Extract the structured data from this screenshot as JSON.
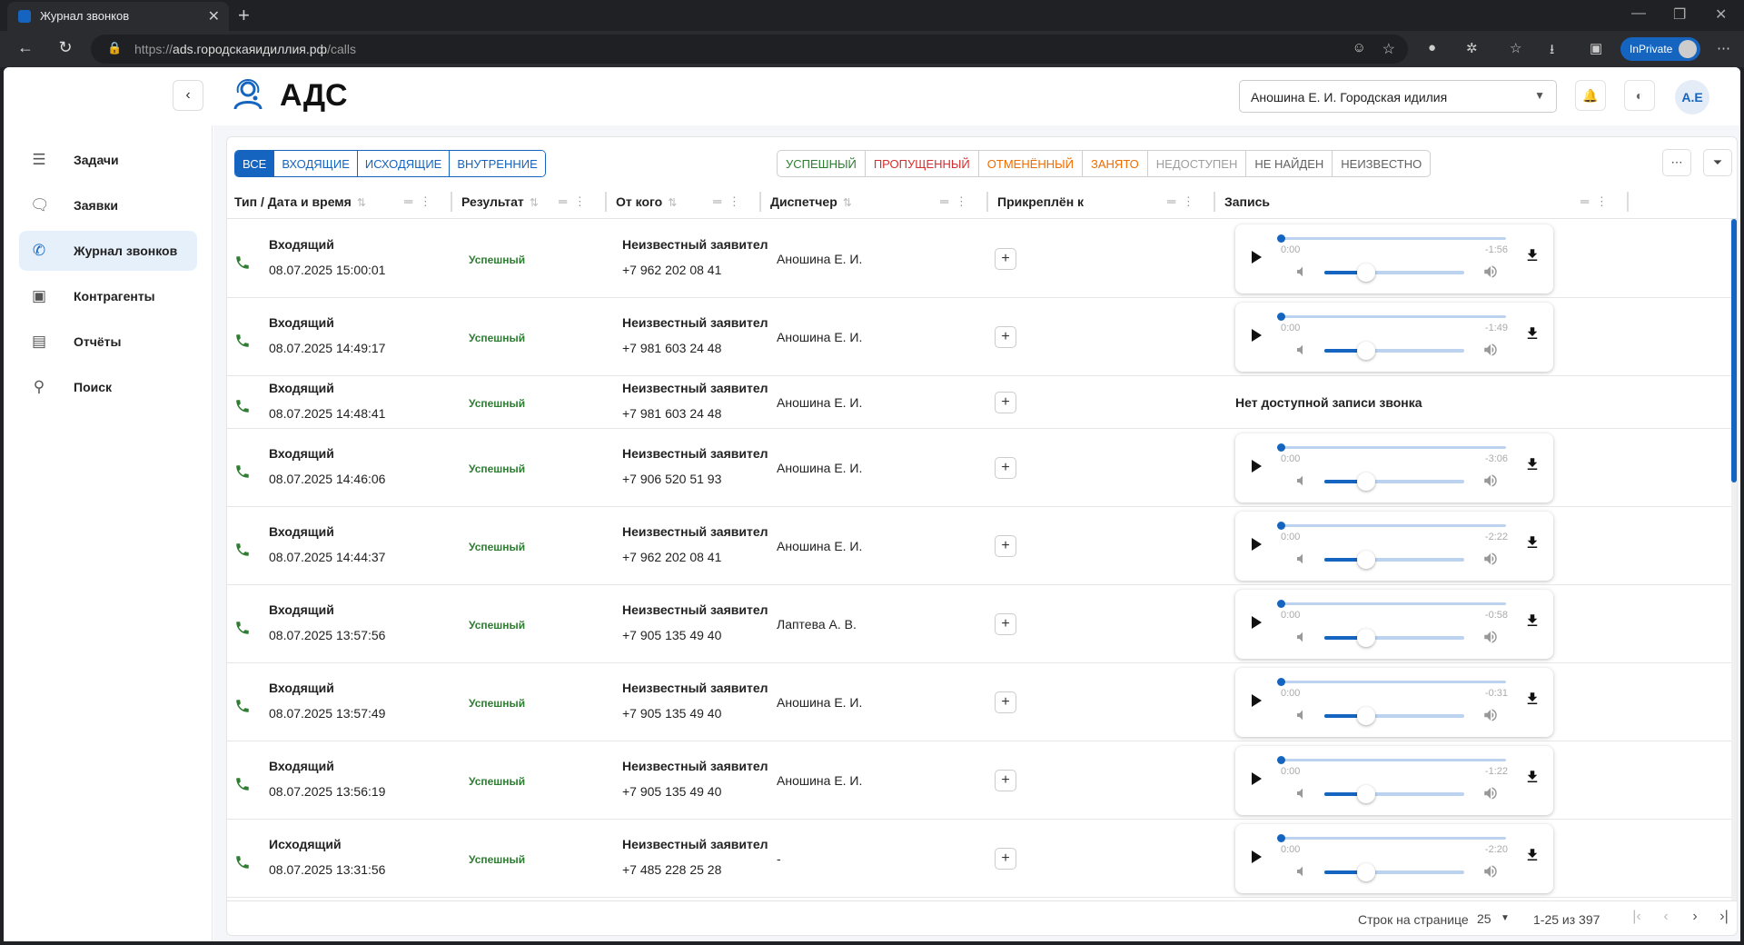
{
  "browser": {
    "tab_title": "Журнал звонков",
    "url_scheme": "https://",
    "url_host": "ads.городскаяидиллия.рф",
    "url_path": "/calls",
    "inprivate_label": "InPrivate"
  },
  "header": {
    "app_title": "АДС",
    "org_select_value": "Аношина Е. И. Городская идилия",
    "avatar_initials": "А.Е"
  },
  "sidebar": {
    "items": [
      {
        "label": "Задачи",
        "icon": "tasks-icon"
      },
      {
        "label": "Заявки",
        "icon": "requests-icon"
      },
      {
        "label": "Журнал звонков",
        "icon": "call-log-icon",
        "active": true
      },
      {
        "label": "Контрагенты",
        "icon": "contacts-icon"
      },
      {
        "label": "Отчёты",
        "icon": "reports-icon"
      },
      {
        "label": "Поиск",
        "icon": "search-icon"
      }
    ]
  },
  "filters": {
    "direction": [
      "ВСЕ",
      "ВХОДЯЩИЕ",
      "ИСХОДЯЩИЕ",
      "ВНУТРЕННИЕ"
    ],
    "direction_selected": "ВСЕ",
    "results": [
      {
        "label": "УСПЕШНЫЙ",
        "color": "#2e7d32"
      },
      {
        "label": "ПРОПУЩЕННЫЙ",
        "color": "#d32f2f"
      },
      {
        "label": "ОТМЕНЁННЫЙ",
        "color": "#ef6c00"
      },
      {
        "label": "ЗАНЯТО",
        "color": "#ef6c00"
      },
      {
        "label": "НЕДОСТУПЕН",
        "color": "#9e9e9e"
      },
      {
        "label": "НЕ НАЙДЕН",
        "color": "#616161"
      },
      {
        "label": "НЕИЗВЕСТНО",
        "color": "#616161"
      }
    ]
  },
  "table": {
    "columns": [
      "Тип / Дата и время",
      "Результат",
      "От кого",
      "Диспетчер",
      "Прикреплён к",
      "Запись"
    ],
    "no_record_text": "Нет доступной записи звонка",
    "rows": [
      {
        "type": "Входящий",
        "datetime": "08.07.2025 15:00:01",
        "result": "Успешный",
        "from_name": "Неизвестный заявител",
        "from_phone": "+7 962 202 08 41",
        "dispatcher": "Аношина Е. И.",
        "has_record": true,
        "time_start": "0:00",
        "time_left": "-1:56"
      },
      {
        "type": "Входящий",
        "datetime": "08.07.2025 14:49:17",
        "result": "Успешный",
        "from_name": "Неизвестный заявител",
        "from_phone": "+7 981 603 24 48",
        "dispatcher": "Аношина Е. И.",
        "has_record": true,
        "time_start": "0:00",
        "time_left": "-1:49"
      },
      {
        "type": "Входящий",
        "datetime": "08.07.2025 14:48:41",
        "result": "Успешный",
        "from_name": "Неизвестный заявител",
        "from_phone": "+7 981 603 24 48",
        "dispatcher": "Аношина Е. И.",
        "has_record": false,
        "time_start": "",
        "time_left": ""
      },
      {
        "type": "Входящий",
        "datetime": "08.07.2025 14:46:06",
        "result": "Успешный",
        "from_name": "Неизвестный заявител",
        "from_phone": "+7 906 520 51 93",
        "dispatcher": "Аношина Е. И.",
        "has_record": true,
        "time_start": "0:00",
        "time_left": "-3:06"
      },
      {
        "type": "Входящий",
        "datetime": "08.07.2025 14:44:37",
        "result": "Успешный",
        "from_name": "Неизвестный заявител",
        "from_phone": "+7 962 202 08 41",
        "dispatcher": "Аношина Е. И.",
        "has_record": true,
        "time_start": "0:00",
        "time_left": "-2:22"
      },
      {
        "type": "Входящий",
        "datetime": "08.07.2025 13:57:56",
        "result": "Успешный",
        "from_name": "Неизвестный заявител",
        "from_phone": "+7 905 135 49 40",
        "dispatcher": "Лаптева А. В.",
        "has_record": true,
        "time_start": "0:00",
        "time_left": "-0:58"
      },
      {
        "type": "Входящий",
        "datetime": "08.07.2025 13:57:49",
        "result": "Успешный",
        "from_name": "Неизвестный заявител",
        "from_phone": "+7 905 135 49 40",
        "dispatcher": "Аношина Е. И.",
        "has_record": true,
        "time_start": "0:00",
        "time_left": "-0:31"
      },
      {
        "type": "Входящий",
        "datetime": "08.07.2025 13:56:19",
        "result": "Успешный",
        "from_name": "Неизвестный заявител",
        "from_phone": "+7 905 135 49 40",
        "dispatcher": "Аношина Е. И.",
        "has_record": true,
        "time_start": "0:00",
        "time_left": "-1:22"
      },
      {
        "type": "Исходящий",
        "datetime": "08.07.2025 13:31:56",
        "result": "Успешный",
        "from_name": "Неизвестный заявител",
        "from_phone": "+7 485 228 25 28",
        "dispatcher": "-",
        "has_record": true,
        "time_start": "0:00",
        "time_left": "-2:20"
      }
    ]
  },
  "pagination": {
    "rows_per_page_label": "Строк на странице",
    "rows_per_page": "25",
    "range": "1-25 из 397"
  },
  "colors": {
    "accent": "#1565c0",
    "success": "#2e7d32",
    "phone_icon": "#2e7d32"
  }
}
